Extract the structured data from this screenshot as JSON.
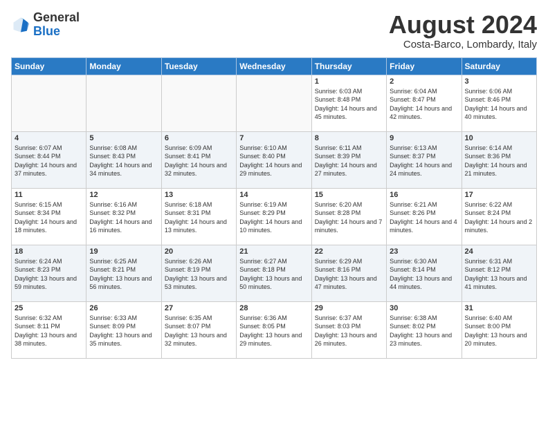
{
  "header": {
    "logo_general": "General",
    "logo_blue": "Blue",
    "month_title": "August 2024",
    "location": "Costa-Barco, Lombardy, Italy"
  },
  "weekdays": [
    "Sunday",
    "Monday",
    "Tuesday",
    "Wednesday",
    "Thursday",
    "Friday",
    "Saturday"
  ],
  "weeks": [
    [
      {
        "num": "",
        "info": ""
      },
      {
        "num": "",
        "info": ""
      },
      {
        "num": "",
        "info": ""
      },
      {
        "num": "",
        "info": ""
      },
      {
        "num": "1",
        "info": "Sunrise: 6:03 AM\nSunset: 8:48 PM\nDaylight: 14 hours and 45 minutes."
      },
      {
        "num": "2",
        "info": "Sunrise: 6:04 AM\nSunset: 8:47 PM\nDaylight: 14 hours and 42 minutes."
      },
      {
        "num": "3",
        "info": "Sunrise: 6:06 AM\nSunset: 8:46 PM\nDaylight: 14 hours and 40 minutes."
      }
    ],
    [
      {
        "num": "4",
        "info": "Sunrise: 6:07 AM\nSunset: 8:44 PM\nDaylight: 14 hours and 37 minutes."
      },
      {
        "num": "5",
        "info": "Sunrise: 6:08 AM\nSunset: 8:43 PM\nDaylight: 14 hours and 34 minutes."
      },
      {
        "num": "6",
        "info": "Sunrise: 6:09 AM\nSunset: 8:41 PM\nDaylight: 14 hours and 32 minutes."
      },
      {
        "num": "7",
        "info": "Sunrise: 6:10 AM\nSunset: 8:40 PM\nDaylight: 14 hours and 29 minutes."
      },
      {
        "num": "8",
        "info": "Sunrise: 6:11 AM\nSunset: 8:39 PM\nDaylight: 14 hours and 27 minutes."
      },
      {
        "num": "9",
        "info": "Sunrise: 6:13 AM\nSunset: 8:37 PM\nDaylight: 14 hours and 24 minutes."
      },
      {
        "num": "10",
        "info": "Sunrise: 6:14 AM\nSunset: 8:36 PM\nDaylight: 14 hours and 21 minutes."
      }
    ],
    [
      {
        "num": "11",
        "info": "Sunrise: 6:15 AM\nSunset: 8:34 PM\nDaylight: 14 hours and 18 minutes."
      },
      {
        "num": "12",
        "info": "Sunrise: 6:16 AM\nSunset: 8:32 PM\nDaylight: 14 hours and 16 minutes."
      },
      {
        "num": "13",
        "info": "Sunrise: 6:18 AM\nSunset: 8:31 PM\nDaylight: 14 hours and 13 minutes."
      },
      {
        "num": "14",
        "info": "Sunrise: 6:19 AM\nSunset: 8:29 PM\nDaylight: 14 hours and 10 minutes."
      },
      {
        "num": "15",
        "info": "Sunrise: 6:20 AM\nSunset: 8:28 PM\nDaylight: 14 hours and 7 minutes."
      },
      {
        "num": "16",
        "info": "Sunrise: 6:21 AM\nSunset: 8:26 PM\nDaylight: 14 hours and 4 minutes."
      },
      {
        "num": "17",
        "info": "Sunrise: 6:22 AM\nSunset: 8:24 PM\nDaylight: 14 hours and 2 minutes."
      }
    ],
    [
      {
        "num": "18",
        "info": "Sunrise: 6:24 AM\nSunset: 8:23 PM\nDaylight: 13 hours and 59 minutes."
      },
      {
        "num": "19",
        "info": "Sunrise: 6:25 AM\nSunset: 8:21 PM\nDaylight: 13 hours and 56 minutes."
      },
      {
        "num": "20",
        "info": "Sunrise: 6:26 AM\nSunset: 8:19 PM\nDaylight: 13 hours and 53 minutes."
      },
      {
        "num": "21",
        "info": "Sunrise: 6:27 AM\nSunset: 8:18 PM\nDaylight: 13 hours and 50 minutes."
      },
      {
        "num": "22",
        "info": "Sunrise: 6:29 AM\nSunset: 8:16 PM\nDaylight: 13 hours and 47 minutes."
      },
      {
        "num": "23",
        "info": "Sunrise: 6:30 AM\nSunset: 8:14 PM\nDaylight: 13 hours and 44 minutes."
      },
      {
        "num": "24",
        "info": "Sunrise: 6:31 AM\nSunset: 8:12 PM\nDaylight: 13 hours and 41 minutes."
      }
    ],
    [
      {
        "num": "25",
        "info": "Sunrise: 6:32 AM\nSunset: 8:11 PM\nDaylight: 13 hours and 38 minutes."
      },
      {
        "num": "26",
        "info": "Sunrise: 6:33 AM\nSunset: 8:09 PM\nDaylight: 13 hours and 35 minutes."
      },
      {
        "num": "27",
        "info": "Sunrise: 6:35 AM\nSunset: 8:07 PM\nDaylight: 13 hours and 32 minutes."
      },
      {
        "num": "28",
        "info": "Sunrise: 6:36 AM\nSunset: 8:05 PM\nDaylight: 13 hours and 29 minutes."
      },
      {
        "num": "29",
        "info": "Sunrise: 6:37 AM\nSunset: 8:03 PM\nDaylight: 13 hours and 26 minutes."
      },
      {
        "num": "30",
        "info": "Sunrise: 6:38 AM\nSunset: 8:02 PM\nDaylight: 13 hours and 23 minutes."
      },
      {
        "num": "31",
        "info": "Sunrise: 6:40 AM\nSunset: 8:00 PM\nDaylight: 13 hours and 20 minutes."
      }
    ]
  ]
}
